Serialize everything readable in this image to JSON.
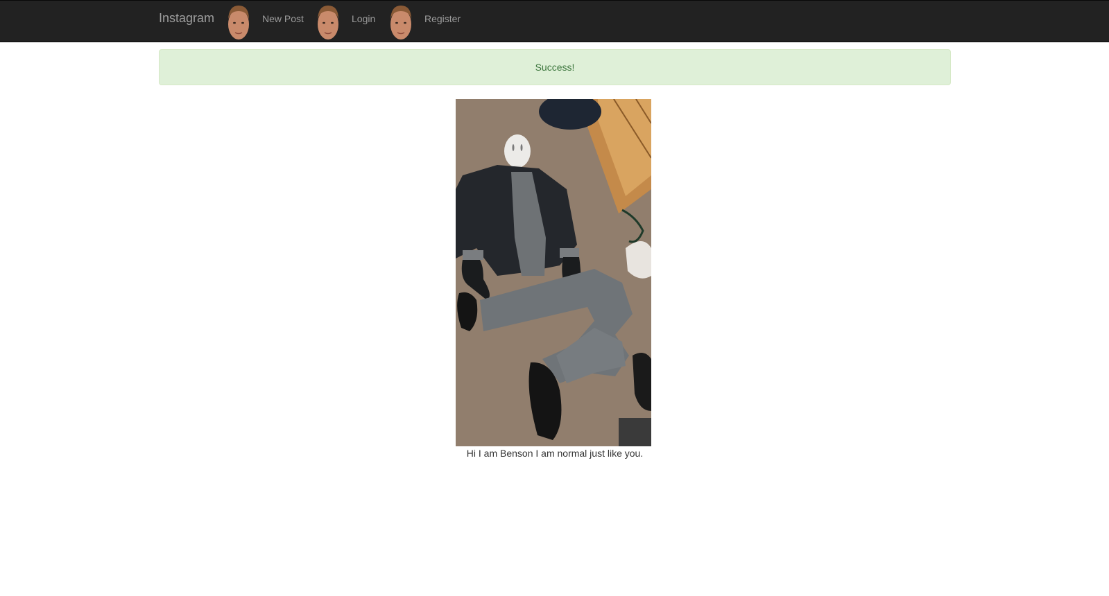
{
  "navbar": {
    "brand": "Instagram",
    "links": [
      {
        "label": "New Post"
      },
      {
        "label": "Login"
      },
      {
        "label": "Register"
      }
    ]
  },
  "alert": {
    "message": "Success!"
  },
  "post": {
    "caption": "Hi I am Benson I am normal just like you."
  },
  "colors": {
    "navbar_bg": "#222222",
    "nav_text": "#9d9d9d",
    "alert_bg": "#dff0d8",
    "alert_text": "#3c763d"
  },
  "icons": [
    "avatar-face-icon",
    "avatar-face-icon",
    "avatar-face-icon"
  ]
}
